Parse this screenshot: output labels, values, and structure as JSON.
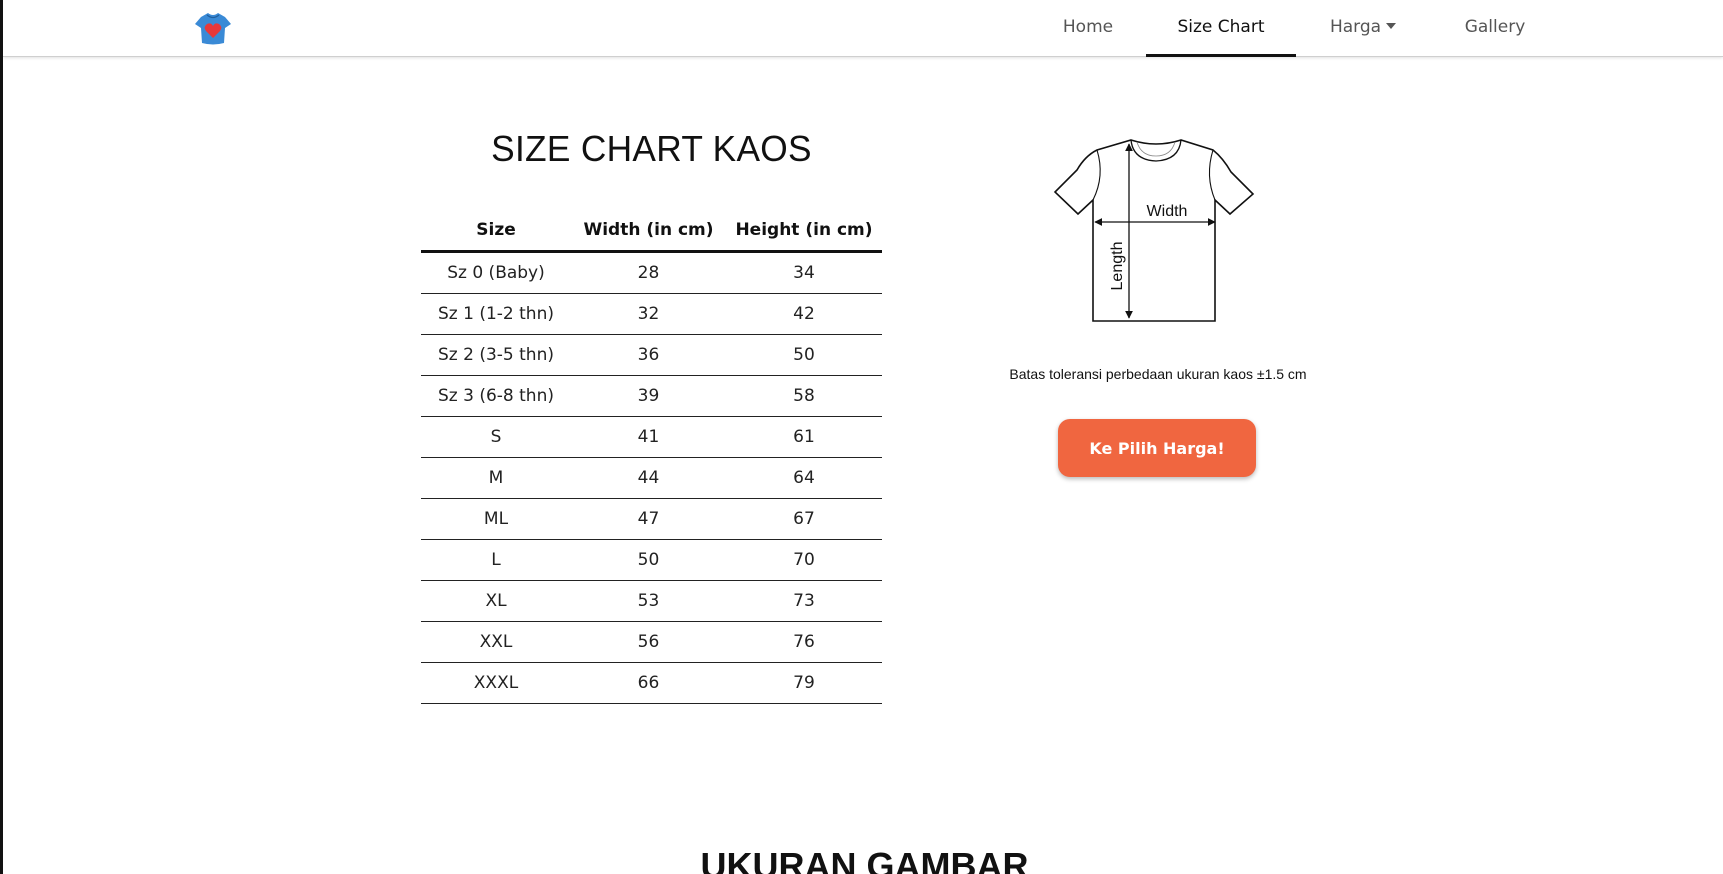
{
  "nav": {
    "logo_icon": "heart-tshirt-icon",
    "items": [
      {
        "label": "Home"
      },
      {
        "label": "Size Chart",
        "active": true
      },
      {
        "label": "Harga",
        "dropdown": true
      },
      {
        "label": "Gallery"
      }
    ]
  },
  "main": {
    "title": "SIZE CHART KAOS",
    "table": {
      "headers": [
        "Size",
        "Width (in cm)",
        "Height (in cm)"
      ],
      "rows": [
        [
          "Sz 0 (Baby)",
          "28",
          "34"
        ],
        [
          "Sz 1 (1-2 thn)",
          "32",
          "42"
        ],
        [
          "Sz 2 (3-5 thn)",
          "36",
          "50"
        ],
        [
          "Sz 3 (6-8 thn)",
          "39",
          "58"
        ],
        [
          "S",
          "41",
          "61"
        ],
        [
          "M",
          "44",
          "64"
        ],
        [
          "ML",
          "47",
          "67"
        ],
        [
          "L",
          "50",
          "70"
        ],
        [
          "XL",
          "53",
          "73"
        ],
        [
          "XXL",
          "56",
          "76"
        ],
        [
          "XXXL",
          "66",
          "79"
        ]
      ]
    },
    "diagram": {
      "width_label": "Width",
      "length_label": "Length"
    },
    "tolerance_text": "Batas toleransi perbedaan ukuran kaos ±1.5 cm",
    "cta_label": "Ke Pilih Harga!",
    "cta_color": "#f06640",
    "next_section_title": "UKURAN GAMBAR"
  }
}
